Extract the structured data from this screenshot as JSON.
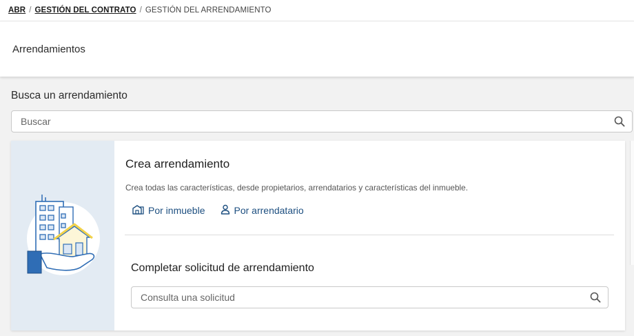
{
  "breadcrumb": {
    "items": [
      "ABR",
      "GESTIÓN DEL CONTRATO"
    ],
    "separator": "/",
    "current": "GESTIÓN DEL ARRENDAMIENTO"
  },
  "header": {
    "title": "Arrendamientos"
  },
  "search": {
    "title": "Busca un arrendamiento",
    "placeholder": "Buscar",
    "icon": "search-icon"
  },
  "create": {
    "title": "Crea arrendamiento",
    "description": "Crea todas las características, desde propietarios, arrendatarios y características del inmueble.",
    "links": [
      {
        "label": "Por inmueble",
        "icon": "building-icon"
      },
      {
        "label": "Por arrendatario",
        "icon": "person-icon"
      }
    ]
  },
  "complete": {
    "title": "Completar solicitud de arrendamiento",
    "placeholder": "Consulta una solicitud",
    "icon": "search-icon"
  },
  "colors": {
    "link": "#1d4f80",
    "aside_bg": "#e3ebf3",
    "illustration_blue": "#2f6db5",
    "illustration_yellow": "#f2d24a"
  }
}
